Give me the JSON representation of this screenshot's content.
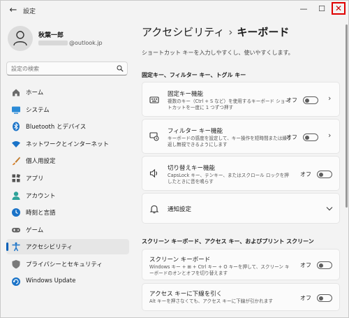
{
  "window": {
    "title": "設定",
    "back_glyph": "←",
    "minimize_glyph": "—",
    "maximize_glyph": "☐",
    "close_glyph": "✕",
    "close_highlight_color": "#e00000"
  },
  "profile": {
    "name": "秋葉一郎",
    "email_suffix": "@outlook.jp"
  },
  "search": {
    "placeholder": "設定の検索"
  },
  "sidebar": {
    "items": [
      {
        "label": "ホーム",
        "icon": "home-icon"
      },
      {
        "label": "システム",
        "icon": "system-icon"
      },
      {
        "label": "Bluetooth とデバイス",
        "icon": "bluetooth-icon"
      },
      {
        "label": "ネットワークとインターネット",
        "icon": "network-icon"
      },
      {
        "label": "個人用設定",
        "icon": "brush-icon"
      },
      {
        "label": "アプリ",
        "icon": "apps-icon"
      },
      {
        "label": "アカウント",
        "icon": "account-icon"
      },
      {
        "label": "時刻と言語",
        "icon": "clock-language-icon"
      },
      {
        "label": "ゲーム",
        "icon": "gamepad-icon"
      },
      {
        "label": "アクセシビリティ",
        "icon": "accessibility-icon",
        "active": true
      },
      {
        "label": "プライバシーとセキュリティ",
        "icon": "shield-icon"
      },
      {
        "label": "Windows Update",
        "icon": "windows-update-icon"
      }
    ]
  },
  "main": {
    "breadcrumb_parent": "アクセシビリティ",
    "breadcrumb_sep": "›",
    "breadcrumb_current": "キーボード",
    "description": "ショートカット キーを入力しやすくし、使いやすくします。",
    "section1_title": "固定キー、フィルター キー、トグル キー",
    "section2_title": "スクリーン キーボード、アクセス キー、およびプリント スクリーン",
    "cards": {
      "sticky": {
        "title": "固定キー機能",
        "desc": "複数のキー（Ctrl + S など）を使用するキーボード ショートカットを一度に 1 つずつ押す",
        "state": "オフ"
      },
      "filter": {
        "title": "フィルター キー機能",
        "desc": "キーボードの感度を設定して、キー操作を短時間または繰り返し無視できるようにします",
        "state": "オフ"
      },
      "toggle": {
        "title": "切り替えキー機能",
        "desc": "CapsLock キー、テンキー、またはスクロール ロックを押したときに音を鳴らす",
        "state": "オフ"
      },
      "notify": {
        "title": "通知設定"
      },
      "osk": {
        "title": "スクリーン キーボード",
        "desc": "Windows キー + ⊞ + Ctrl キー + O キーを押して、スクリーン キーボードのオンとオフを切り替えます",
        "state": "オフ"
      },
      "underline": {
        "title": "アクセス キーに下線を引く",
        "desc": "Alt キーを押さなくても、アクセス キーに下線が引かれます",
        "state": "オフ"
      }
    }
  }
}
